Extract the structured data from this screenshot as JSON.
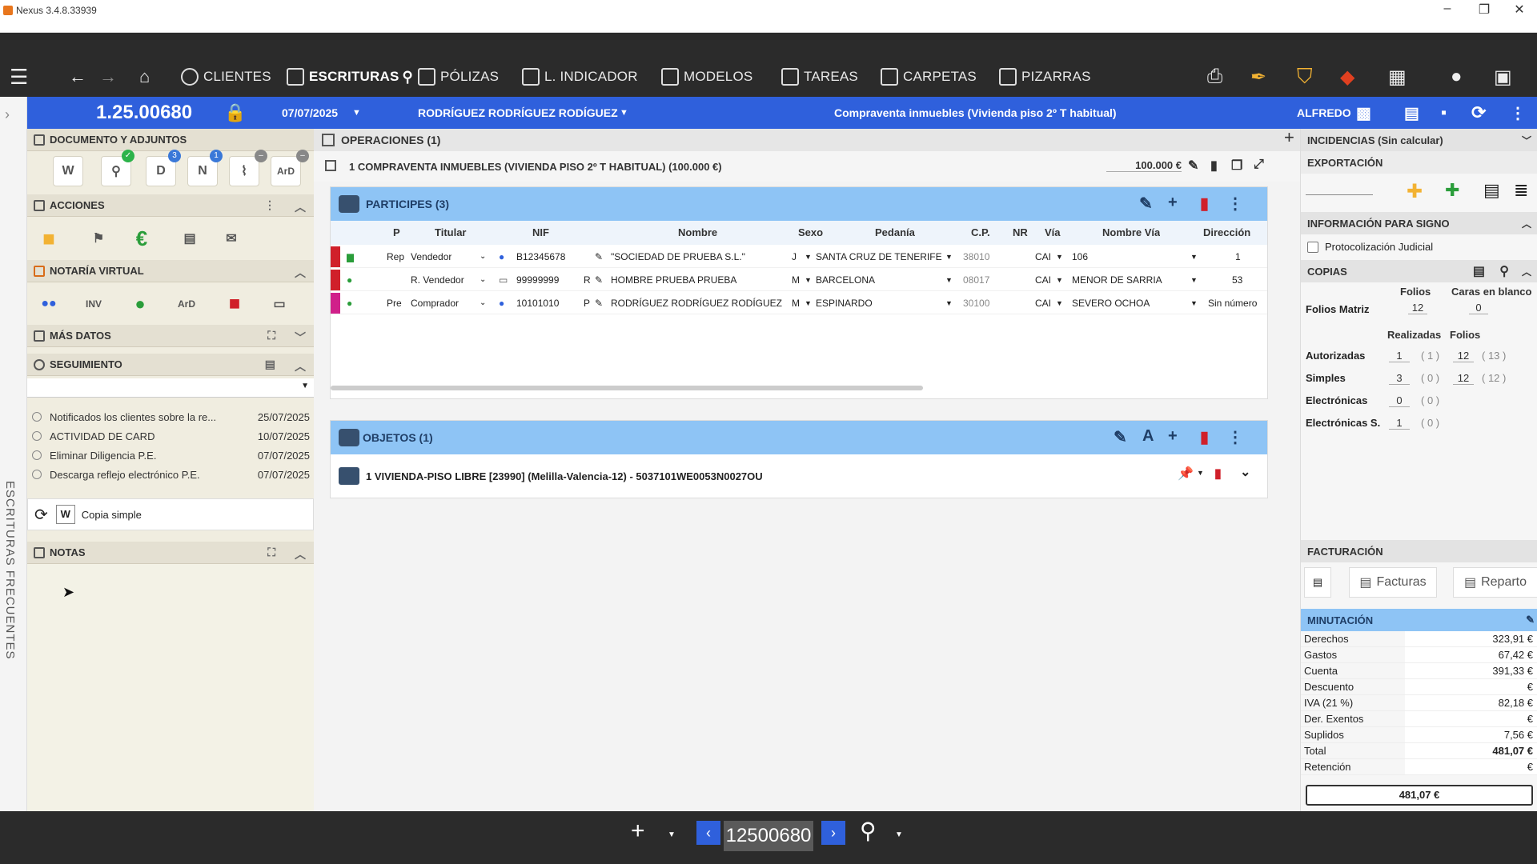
{
  "titlebar": {
    "app_name": "Nexus  3.4.8.33939",
    "minimize": "–",
    "restore": "❐",
    "close": "✕"
  },
  "nav": {
    "items": [
      {
        "label": "CLIENTES"
      },
      {
        "label": "ESCRITURAS"
      },
      {
        "label": "PÓLIZAS"
      },
      {
        "label": "L. INDICADOR"
      },
      {
        "label": "MODELOS"
      },
      {
        "label": "TAREAS"
      },
      {
        "label": "CARPETAS"
      },
      {
        "label": "PIZARRAS"
      }
    ]
  },
  "header": {
    "protocol": "1.25.00680",
    "date": "07/07/2025",
    "client": "RODRÍGUEZ RODRÍGUEZ RODÍGUEZ",
    "description": "Compraventa inmuebles (Vivienda piso 2º T habitual)",
    "user": "ALFREDO"
  },
  "leftstrip": {
    "vertical_label": "ESCRITURAS FRECUENTES"
  },
  "left": {
    "documento": {
      "title": "DOCUMENTO Y ADJUNTOS",
      "btn_w": "W",
      "btn_d": "D",
      "btn_n": "N",
      "badge_d": "3",
      "badge_n": "1"
    },
    "acciones": {
      "title": "ACCIONES",
      "euro": "€"
    },
    "notaria": {
      "title": "NOTARÍA VIRTUAL"
    },
    "mas_datos": {
      "title": "MÁS DATOS"
    },
    "seguimiento": {
      "title": "SEGUIMIENTO",
      "rows": [
        {
          "text": "Notificados los clientes sobre la re...",
          "date": "25/07/2025"
        },
        {
          "text": "ACTIVIDAD DE CARD",
          "date": "10/07/2025"
        },
        {
          "text": "Eliminar Diligencia P.E.",
          "date": "07/07/2025"
        },
        {
          "text": "Descarga reflejo electrónico P.E.",
          "date": "07/07/2025"
        }
      ],
      "copia_simple": "Copia simple",
      "copia_w": "W"
    },
    "notas": {
      "title": "NOTAS"
    }
  },
  "center": {
    "operaciones_title": "OPERACIONES (1)",
    "operation_line": "1  COMPRAVENTA INMUEBLES (VIVIENDA PISO 2º T HABITUAL) (100.000 €)",
    "operation_amount": "100.000 €",
    "participes": {
      "title": "PARTICIPES (3)",
      "columns": [
        "P",
        "Titular",
        "NIF",
        "Nombre",
        "Sexo",
        "Pedanía",
        "C.P.",
        "NR",
        "Vía",
        "Nombre Vía",
        "Dirección"
      ],
      "rows": [
        {
          "p": "Rep",
          "titular": "Vendedor",
          "nif": "B12345678",
          "nif_t": "",
          "nombre": "\"SOCIEDAD DE PRUEBA S.L.\"",
          "sexo": "J",
          "pedania": "SANTA CRUZ DE TENERIFE",
          "cp": "38010",
          "via": "CAI",
          "nombre_via": "106",
          "direccion": "1",
          "color": "#d0202a"
        },
        {
          "p": "",
          "titular": "R. Vendedor",
          "nif": "99999999",
          "nif_t": "R",
          "nombre": "HOMBRE PRUEBA PRUEBA",
          "sexo": "M",
          "pedania": "BARCELONA",
          "cp": "08017",
          "via": "CAI",
          "nombre_via": "MENOR DE SARRIA",
          "direccion": "53",
          "color": "#d0202a"
        },
        {
          "p": "Pre",
          "titular": "Comprador",
          "nif": "10101010",
          "nif_t": "P",
          "nombre": "RODRÍGUEZ RODRÍGUEZ RODÍGUEZ",
          "sexo": "M",
          "pedania": "ESPINARDO",
          "cp": "30100",
          "via": "CAI",
          "nombre_via": "SEVERO OCHOA",
          "direccion": "Sin número",
          "color": "#d0208a"
        }
      ]
    },
    "objetos": {
      "title": "OBJETOS (1)",
      "row": "1   VIVIENDA-PISO LIBRE [23990] (Melilla-Valencia-12) - 5037101WE0053N0027OU"
    }
  },
  "right": {
    "incidencias": "INCIDENCIAS (Sin calcular)",
    "exportacion": "EXPORTACIÓN",
    "info_signo": "INFORMACIÓN PARA SIGNO",
    "protocolizacion": "Protocolización Judicial",
    "copias": {
      "title": "COPIAS",
      "folios_h": "Folios",
      "caras_h": "Caras en blanco",
      "folios_matriz_label": "Folios Matriz",
      "folios_matriz": "12",
      "caras": "0",
      "realizadas_h": "Realizadas",
      "folios2_h": "Folios",
      "rows": [
        {
          "label": "Autorizadas",
          "r": "1",
          "rp": "( 1 )",
          "f": "12",
          "fp": "( 13 )"
        },
        {
          "label": "Simples",
          "r": "3",
          "rp": "( 0 )",
          "f": "12",
          "fp": "( 12 )"
        },
        {
          "label": "Electrónicas",
          "r": "0",
          "rp": "( 0 )",
          "f": "",
          "fp": ""
        },
        {
          "label": "Electrónicas S.",
          "r": "1",
          "rp": "( 0 )",
          "f": "",
          "fp": ""
        }
      ]
    },
    "facturacion": {
      "title": "FACTURACIÓN",
      "facturas": "Facturas",
      "reparto": "Reparto"
    },
    "minutacion": {
      "title": "MINUTACIÓN",
      "rows": [
        {
          "label": "Derechos",
          "value": "323,91 €"
        },
        {
          "label": "Gastos",
          "value": "67,42 €"
        },
        {
          "label": "Cuenta",
          "value": "391,33 €"
        },
        {
          "label": "Descuento",
          "value": "€"
        },
        {
          "label": "IVA (21 %)",
          "value": "82,18 €"
        },
        {
          "label": "Der. Exentos",
          "value": "€"
        },
        {
          "label": "Suplidos",
          "value": "7,56 €"
        },
        {
          "label": "Total",
          "value": "481,07 €"
        },
        {
          "label": "Retención",
          "value": "€"
        }
      ],
      "grand_total": "481,07 €"
    }
  },
  "bottom": {
    "record_number": "12500680",
    "prev": "‹",
    "next": "›",
    "plus": "+",
    "search": "⚲"
  },
  "colors": {
    "header_blue": "#2f60dc",
    "card_blue": "#8ec4f5",
    "nav_dark": "#2b2b2b",
    "delete_red": "#d0202a"
  }
}
